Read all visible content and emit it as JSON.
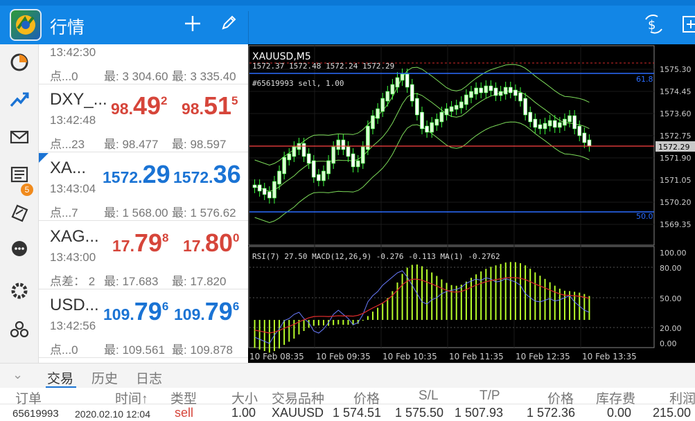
{
  "header": {
    "title": "行情",
    "add_icon": "plus-icon",
    "edit_icon": "pencil-icon"
  },
  "sidebar": {
    "mail_badge": "5",
    "icons": [
      "quotes-icon",
      "chart-icon",
      "mail-icon",
      "news-icon",
      "trade-icon",
      "chat-icon",
      "settings-icon",
      "community-icon"
    ]
  },
  "quotes": [
    {
      "symbol": "",
      "time": "13:42:30",
      "spread": "点...0",
      "low": "最: 3 304.60",
      "high": "最: 3 335.40",
      "bid_pre": "",
      "bid_big": "",
      "bid_sup": "",
      "ask_pre": "",
      "ask_big": "",
      "ask_sup": ""
    },
    {
      "symbol": "DXY_...",
      "time": "13:42:48",
      "spread": "点...23",
      "low": "最: 98.477",
      "high": "最: 98.597",
      "bid_pre": "98.",
      "bid_big": "49",
      "bid_sup": "2",
      "ask_pre": "98.",
      "ask_big": "51",
      "ask_sup": "5",
      "color": "red"
    },
    {
      "symbol": "XA...",
      "time": "13:43:04",
      "spread": "点...7",
      "low": "最: 1 568.00",
      "high": "最: 1 576.62",
      "bid_pre": "1572.",
      "bid_big": "29",
      "bid_sup": "",
      "ask_pre": "1572.",
      "ask_big": "36",
      "ask_sup": "",
      "color": "blue"
    },
    {
      "symbol": "XAG...",
      "time": "13:43:00",
      "spread": "点差： 2",
      "low": "最: 17.683",
      "high": "最: 17.820",
      "bid_pre": "17.",
      "bid_big": "79",
      "bid_sup": "8",
      "ask_pre": "17.",
      "ask_big": "80",
      "ask_sup": "0",
      "color": "red"
    },
    {
      "symbol": "USD...",
      "time": "13:42:56",
      "spread": "点...0",
      "low": "最: 109.561",
      "high": "最: 109.878",
      "bid_pre": "109.",
      "bid_big": "79",
      "bid_sup": "6",
      "ask_pre": "109.",
      "ask_big": "79",
      "ask_sup": "6",
      "color": "blue"
    }
  ],
  "chart": {
    "symbol_title": "XAUUSD,M5",
    "ohlc": "1572.37 1572.48 1572.24 1572.29",
    "order_label": "#65619993 sell, 1.00",
    "level_top": "61.8",
    "level_bottom": "50.0",
    "current_price": "1572.29",
    "price_ticks": [
      "1575.30",
      "1574.45",
      "1573.60",
      "1572.75",
      "1571.90",
      "1571.05",
      "1570.20",
      "1569.35"
    ],
    "indicator_label": "RSI(7) 27.50 MACD(12,26,9) -0.276 -0.113 MA(1) -0.2762",
    "indicator_ticks": [
      "100.00",
      "80.00",
      "50.00",
      "20.00",
      "0.00"
    ],
    "time_ticks": [
      "10 Feb 08:35",
      "10 Feb 09:35",
      "10 Feb 10:35",
      "10 Feb 11:35",
      "10 Feb 12:35",
      "10 Feb 13:35"
    ],
    "colors": {
      "bull": "#d8ffd0",
      "bear": "#ffffff",
      "wick": "#3cff3c",
      "bands": "#7ddc5a",
      "hist": "#b8ff2a",
      "rsi": "#6a7cff",
      "signal": "#d42a2a",
      "level": "#2a6cff"
    }
  },
  "bottom": {
    "tabs": [
      "交易",
      "历史",
      "日志"
    ],
    "columns": [
      "订单",
      "时间↑",
      "类型",
      "大小",
      "交易品种",
      "价格",
      "S/L",
      "T/P",
      "价格",
      "库存费",
      "利润"
    ],
    "order": {
      "ticket": "65619993",
      "time": "2020.02.10 12:04",
      "type": "sell",
      "size": "1.00",
      "symbol": "XAUUSD",
      "open_price": "1 574.51",
      "sl": "1 575.50",
      "tp": "1 507.93",
      "price": "1 572.36",
      "swap": "0.00",
      "profit": "215.00"
    }
  }
}
